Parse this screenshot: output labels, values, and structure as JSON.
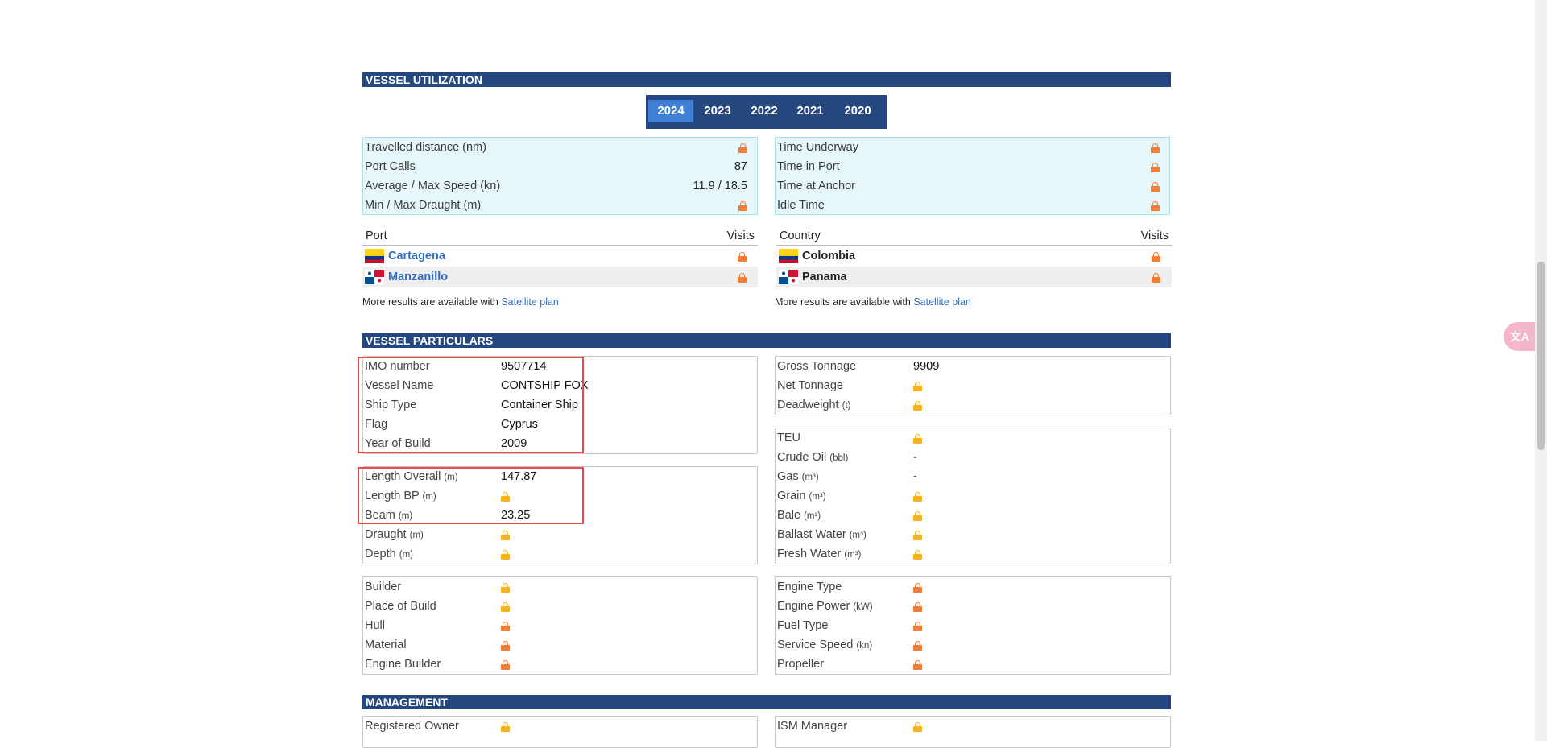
{
  "utilization": {
    "title": "VESSEL UTILIZATION",
    "years": [
      "2024",
      "2023",
      "2022",
      "2021",
      "2020"
    ],
    "left_stats": [
      {
        "label": "Travelled distance (nm)",
        "value": null
      },
      {
        "label": "Port Calls",
        "value": "87"
      },
      {
        "label": "Average / Max Speed (kn)",
        "value": "11.9 / 18.5"
      },
      {
        "label": "Min / Max Draught (m)",
        "value": null
      }
    ],
    "right_stats": [
      {
        "label": "Time Underway",
        "value": null
      },
      {
        "label": "Time in Port",
        "value": null
      },
      {
        "label": "Time at Anchor",
        "value": null
      },
      {
        "label": "Idle Time",
        "value": null
      }
    ],
    "ports": {
      "col1": "Port",
      "col2": "Visits",
      "rows": [
        {
          "name": "Cartagena",
          "flag": "colombia"
        },
        {
          "name": "Manzanillo",
          "flag": "panama"
        }
      ]
    },
    "countries": {
      "col1": "Country",
      "col2": "Visits",
      "rows": [
        {
          "name": "Colombia",
          "flag": "colombia"
        },
        {
          "name": "Panama",
          "flag": "panama"
        }
      ]
    },
    "more_text": "More results are available with",
    "more_link": "Satellite plan"
  },
  "particulars": {
    "title": "VESSEL PARTICULARS",
    "box1": [
      {
        "label": "IMO number",
        "value": "9507714"
      },
      {
        "label": "Vessel Name",
        "value": "CONTSHIP FOX"
      },
      {
        "label": "Ship Type",
        "value": "Container Ship"
      },
      {
        "label": "Flag",
        "value": "Cyprus"
      },
      {
        "label": "Year of Build",
        "value": "2009"
      }
    ],
    "box2": [
      {
        "label": "Length Overall",
        "unit": "(m)",
        "value": "147.87"
      },
      {
        "label": "Length BP",
        "unit": "(m)",
        "value": null,
        "lock": "yellow"
      },
      {
        "label": "Beam",
        "unit": "(m)",
        "value": "23.25"
      },
      {
        "label": "Draught",
        "unit": "(m)",
        "value": null,
        "lock": "yellow"
      },
      {
        "label": "Depth",
        "unit": "(m)",
        "value": null,
        "lock": "yellow"
      }
    ],
    "box3": [
      {
        "label": "Builder",
        "lock": "yellow"
      },
      {
        "label": "Place of Build",
        "lock": "yellow"
      },
      {
        "label": "Hull",
        "lock": "orange"
      },
      {
        "label": "Material",
        "lock": "orange"
      },
      {
        "label": "Engine Builder",
        "lock": "orange"
      }
    ],
    "box4": [
      {
        "label": "Gross Tonnage",
        "value": "9909"
      },
      {
        "label": "Net Tonnage",
        "lock": "yellow"
      },
      {
        "label": "Deadweight",
        "unit": "(t)",
        "lock": "yellow"
      }
    ],
    "box5": [
      {
        "label": "TEU",
        "lock": "yellow"
      },
      {
        "label": "Crude Oil",
        "unit": "(bbl)",
        "value": "-"
      },
      {
        "label": "Gas",
        "unit": "(m³)",
        "value": "-"
      },
      {
        "label": "Grain",
        "unit": "(m³)",
        "lock": "yellow"
      },
      {
        "label": "Bale",
        "unit": "(m³)",
        "lock": "yellow"
      },
      {
        "label": "Ballast Water",
        "unit": "(m³)",
        "lock": "yellow"
      },
      {
        "label": "Fresh Water",
        "unit": "(m³)",
        "lock": "yellow"
      }
    ],
    "box6": [
      {
        "label": "Engine Type",
        "lock": "orange"
      },
      {
        "label": "Engine Power",
        "unit": "(kW)",
        "lock": "orange"
      },
      {
        "label": "Fuel Type",
        "lock": "orange"
      },
      {
        "label": "Service Speed",
        "unit": "(kn)",
        "lock": "orange"
      },
      {
        "label": "Propeller",
        "lock": "orange"
      }
    ]
  },
  "management": {
    "title": "MANAGEMENT",
    "left": [
      {
        "label": "Registered Owner",
        "lock": "yellow"
      }
    ],
    "right": [
      {
        "label": "ISM Manager",
        "lock": "yellow"
      }
    ]
  },
  "translate_label": "文A",
  "colors": {
    "header": "#24477f",
    "active_tab": "#3f7fd6",
    "stat_bg": "#e6f7fc",
    "link": "#2f6cc9",
    "lock_orange": "#f07d33",
    "lock_yellow": "#f5b31f",
    "highlight": "#e84b4b"
  }
}
